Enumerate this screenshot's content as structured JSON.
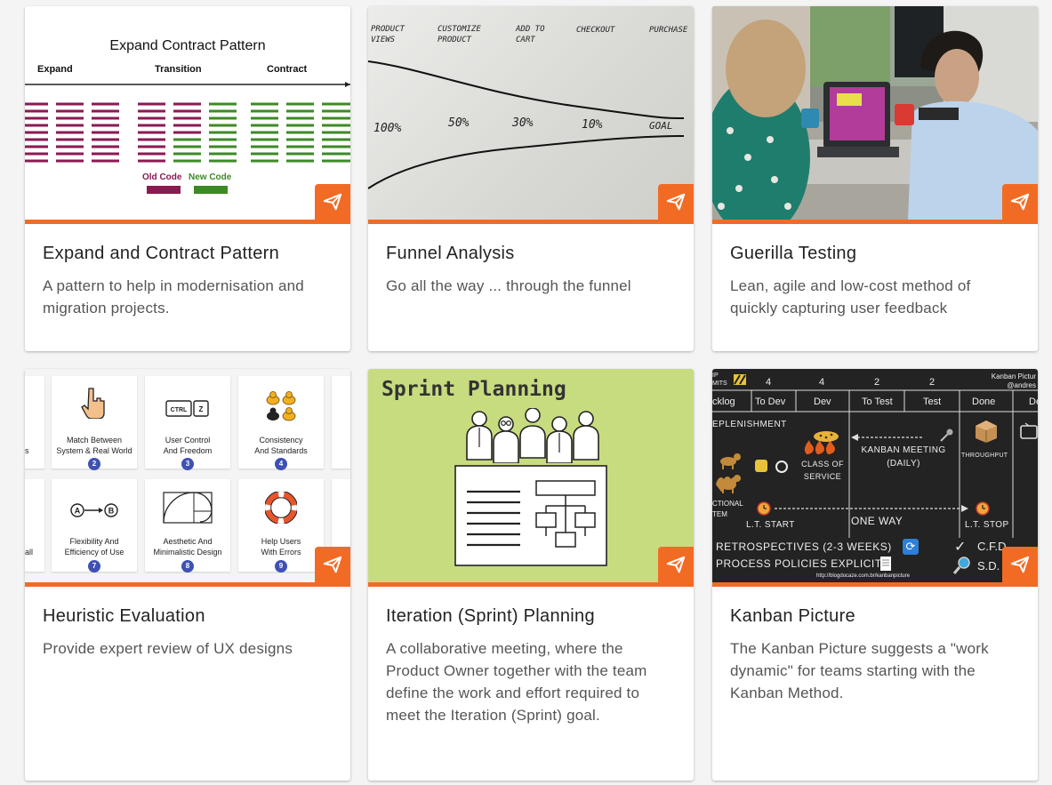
{
  "accent_color": "#f26b24",
  "cards": [
    {
      "title": "Expand and Contract Pattern",
      "description": "A pattern to help in modernisation and migration projects.",
      "image": {
        "heading": "Expand Contract Pattern",
        "phases": [
          "Expand",
          "Transition",
          "Contract"
        ],
        "legend_old": "Old Code",
        "legend_new": "New Code",
        "old_color": "#8a1a52",
        "new_color": "#3c8a25"
      }
    },
    {
      "title": "Funnel Analysis",
      "description": "Go all the way ... through the funnel",
      "image": {
        "stages": [
          "PRODUCT VIEWS",
          "CUSTOMIZE PRODUCT",
          "ADD TO CART",
          "CHECKOUT",
          "PURCHASE"
        ],
        "percents": [
          "100%",
          "50%",
          "30%",
          "10%",
          "GOAL"
        ]
      }
    },
    {
      "title": "Guerilla Testing",
      "description": "Lean, agile and low-cost method of quickly capturing user feedback",
      "image": {
        "kind": "photo"
      }
    },
    {
      "title": "Heuristic Evaluation",
      "description": "Provide expert review of UX designs",
      "image": {
        "tiles": [
          {
            "label": "Match Between System & Real World",
            "num": "2",
            "icon": "pointer-hand-icon"
          },
          {
            "label": "User Control And Freedom",
            "num": "3",
            "icon": "keyboard-keys-icon"
          },
          {
            "label": "Consistency And Standards",
            "num": "4",
            "icon": "ducks-icon"
          },
          {
            "label": "Flexibility And Efficiency of Use",
            "num": "7",
            "icon": "a-to-b-icon"
          },
          {
            "label": "Aesthetic And Minimalistic Design",
            "num": "8",
            "icon": "golden-spiral-icon"
          },
          {
            "label": "Help Users With Errors",
            "num": "9",
            "icon": "life-ring-icon"
          }
        ],
        "left_fragments": [
          "s",
          "all"
        ]
      }
    },
    {
      "title": "Iteration (Sprint) Planning",
      "description": "A collaborative meeting, where the Product Owner together with the team define the work and effort required to meet the Iteration (Sprint) goal.",
      "image": {
        "heading": "Sprint Planning"
      }
    },
    {
      "title": "Kanban Picture",
      "description": "The Kanban Picture suggests a \"work dynamic\" for teams starting with the Kanban Method.",
      "image": {
        "corner_title": "Kanban Pictur",
        "corner_sub": "@andres",
        "wip_label": "IP\nMITS",
        "limits": [
          "4",
          "4",
          "2",
          "2"
        ],
        "columns": [
          "cklog",
          "To Dev",
          "Dev",
          "To Test",
          "Test",
          "Done",
          "Dep"
        ],
        "replenishment": "EPLENISHMENT",
        "class_service": "CLASS OF SERVICE",
        "meeting": "KANBAN MEETING (DAILY)",
        "throughput": "THROUGHPUT",
        "functional": "CTIONAL TEM",
        "lt_start": "L.T. START",
        "one_way": "ONE WAY",
        "lt_stop": "L.T. STOP",
        "retro": "RETROSPECTIVES (2-3 WEEKS)",
        "policies": "PROCESS POLICIES EXPLICIT",
        "cfd": "C.F.D.",
        "sd": "S.D.",
        "url": "http://blogdocaze.com.br/kanbanpicture"
      }
    }
  ]
}
